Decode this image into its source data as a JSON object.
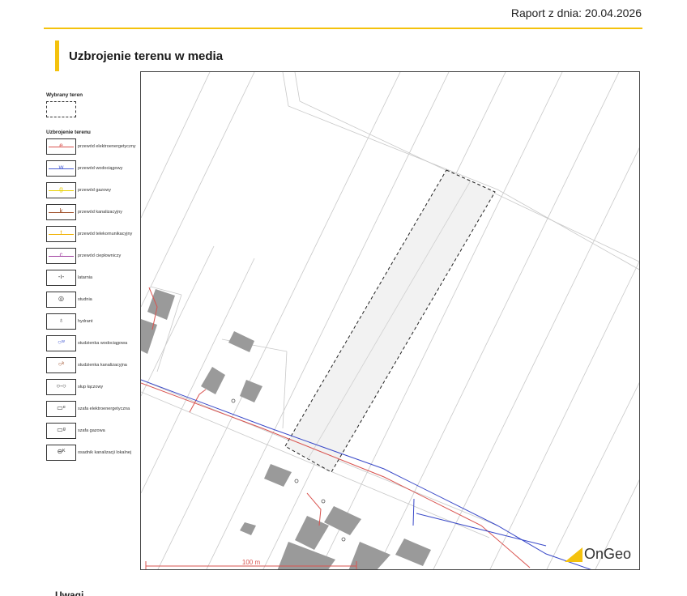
{
  "header": {
    "report_date": "Raport z dnia: 20.04.2026"
  },
  "section": {
    "title": "Uzbrojenie terenu w media"
  },
  "legend": {
    "selected_heading": "Wybrany teren",
    "media_heading": "Uzbrojenie terenu",
    "items": [
      {
        "label": "przewód elektroenergetyczny",
        "color": "#d9534f",
        "glyph": "e"
      },
      {
        "label": "przewód wodociągowy",
        "color": "#4a5fd4",
        "glyph": "w"
      },
      {
        "label": "przewód gazowy",
        "color": "#e8d000",
        "glyph": "g"
      },
      {
        "label": "przewód kanalizacyjny",
        "color": "#a0522d",
        "glyph": "k"
      },
      {
        "label": "przewód telekomunikacyjny",
        "color": "#f0b000",
        "glyph": "t"
      },
      {
        "label": "przewód ciepłowniczy",
        "color": "#a040a0",
        "glyph": "c"
      },
      {
        "label": "latarnia",
        "color": "#333333",
        "glyph": "-ı-"
      },
      {
        "label": "studnia",
        "color": "#333333",
        "glyph": "◎"
      },
      {
        "label": "hydrant",
        "color": "#333333",
        "glyph": "♁"
      },
      {
        "label": "studzienka wodociągowa",
        "color": "#4a5fd4",
        "glyph": "○ʷ"
      },
      {
        "label": "studzienka kanalizacyjna",
        "color": "#a0522d",
        "glyph": "○ᵏ"
      },
      {
        "label": "słup łączowy",
        "color": "#333333",
        "glyph": "○-○"
      },
      {
        "label": "szafa elektroenergetyczna",
        "color": "#333333",
        "glyph": "▭ᵉ"
      },
      {
        "label": "szafa gazowa",
        "color": "#333333",
        "glyph": "▭ᵍ"
      },
      {
        "label": "osadnik kanalizacji lokalnej",
        "color": "#333333",
        "glyph": "⊖ᴷ"
      }
    ]
  },
  "map": {
    "scale_label": "100 m",
    "logo_text": "OnGeo",
    "colors": {
      "power": "#d9534f",
      "water": "#3848c8",
      "parcel_fill": "#f2f2f2",
      "building": "#9a9a9a",
      "accent": "#f4c20d"
    }
  },
  "remarks": {
    "title": "Uwagi"
  }
}
